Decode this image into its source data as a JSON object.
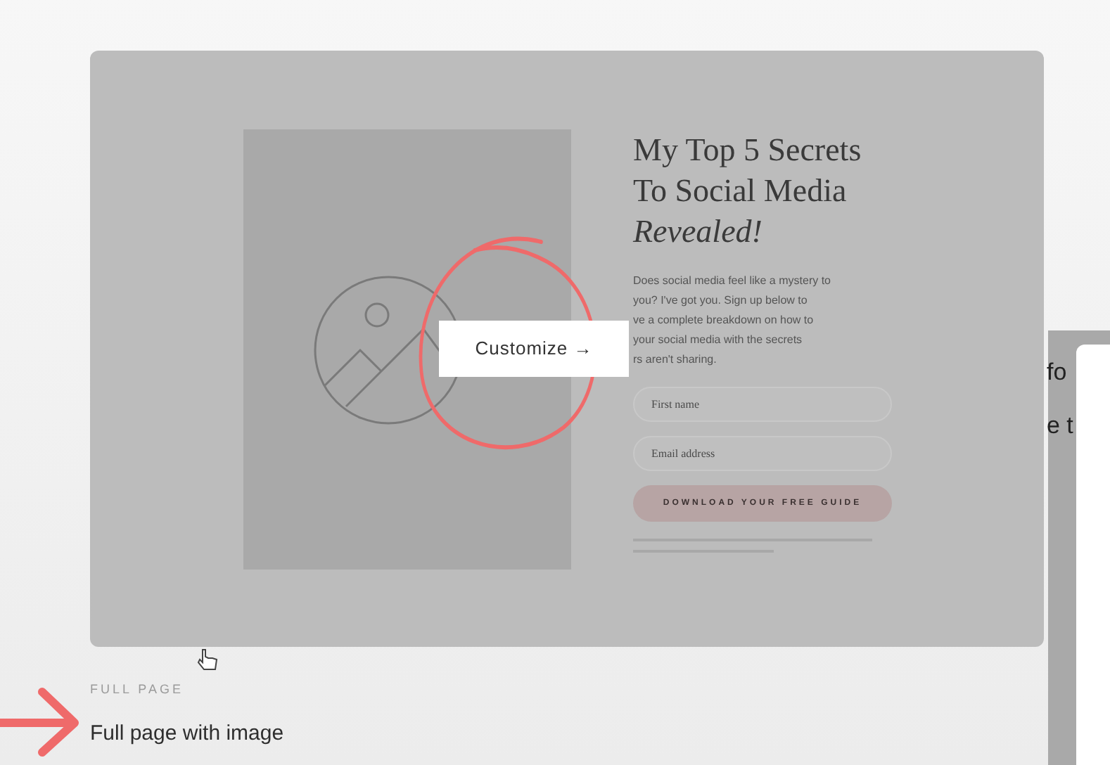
{
  "preview": {
    "headline": [
      "My Top 5 Secrets",
      "To Social Media"
    ],
    "headline_emphasis": "Revealed!",
    "body": [
      "Does social media feel like a mystery to",
      "you? I've got you. Sign up below to",
      "ve a complete breakdown on how to",
      "your social media with the secrets",
      "rs aren't sharing."
    ],
    "fields": [
      {
        "placeholder": "First name"
      },
      {
        "placeholder": "Email address"
      }
    ],
    "cta": "DOWNLOAD YOUR FREE GUIDE",
    "customize_button": "Customize →"
  },
  "template": {
    "category": "FULL PAGE",
    "name": "Full page with image"
  },
  "side_panel": {
    "lines": [
      "fo",
      "e t"
    ]
  }
}
